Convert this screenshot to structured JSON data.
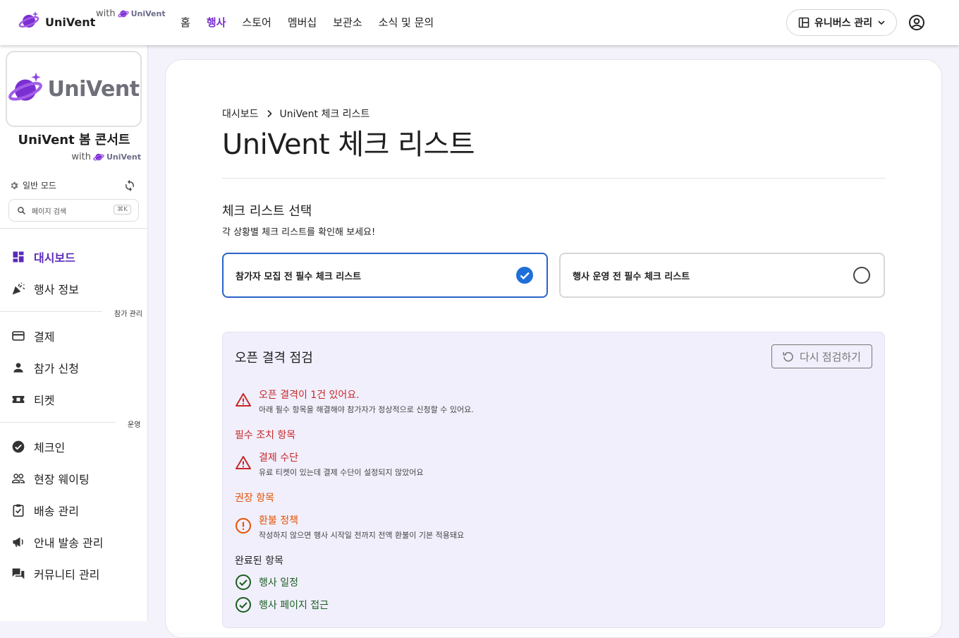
{
  "header": {
    "brand": "UniVent",
    "with": "with",
    "with_brand": "UniVent",
    "nav": [
      "홈",
      "행사",
      "스토어",
      "멤버십",
      "보관소",
      "소식 및 문의"
    ],
    "active_nav": "행사",
    "manage_label": "유니버스 관리"
  },
  "sidebar": {
    "logo_text": "UniVent",
    "event_name": "UniVent 봄 콘서트",
    "event_with": "with",
    "event_with_brand": "UniVent",
    "mode_label": "일반 모드",
    "search_placeholder": "페이지 검색",
    "search_shortcut": "⌘K",
    "section_participants": "참가 관리",
    "section_operations": "운영",
    "items": [
      {
        "label": "대시보드",
        "icon": "dashboard-icon"
      },
      {
        "label": "행사 정보",
        "icon": "party-popper-icon"
      },
      {
        "label": "결제",
        "icon": "credit-card-icon"
      },
      {
        "label": "참가 신청",
        "icon": "person-icon"
      },
      {
        "label": "티켓",
        "icon": "ticket-icon"
      },
      {
        "label": "체크인",
        "icon": "check-circle-icon"
      },
      {
        "label": "현장 웨이팅",
        "icon": "people-icon"
      },
      {
        "label": "배송 관리",
        "icon": "clipboard-check-icon"
      },
      {
        "label": "안내 발송 관리",
        "icon": "megaphone-icon"
      },
      {
        "label": "커뮤니티 관리",
        "icon": "forum-icon"
      }
    ]
  },
  "main": {
    "breadcrumb": [
      "대시보드",
      "UniVent 체크 리스트"
    ],
    "title": "UniVent 체크 리스트",
    "select_title": "체크 리스트 선택",
    "select_desc": "각 상황별 체크 리스트를 확인해 보세요!",
    "options": [
      {
        "label": "참가자 모집 전 필수 체크 리스트",
        "selected": true
      },
      {
        "label": "행사 운영 전 필수 체크 리스트",
        "selected": false
      }
    ],
    "panel": {
      "title": "오픈 결격 점검",
      "recheck_label": "다시 점검하기",
      "summary_title": "오픈 결격이 1건 있어요.",
      "summary_desc": "아래 필수 항목을 해결해야 참가자가 정상적으로 신청할 수 있어요.",
      "required_label": "필수 조치 항목",
      "required_item_title": "결제 수단",
      "required_item_desc": "유료 티켓이 있는데 결제 수단이 설정되지 않았어요",
      "recommended_label": "권장 항목",
      "recommended_item_title": "환불 정책",
      "recommended_item_desc": "작성하지 않으면 행사 시작일 전까지 전액 환불이 기본 적용돼요",
      "completed_label": "완료된 항목",
      "completed_items": [
        "행사 일정",
        "행사 페이지 접근"
      ]
    },
    "colors": {
      "accent": "#7b2fd1",
      "selected_border": "#2a63c9",
      "error": "#c62828",
      "warning": "#e65100",
      "success": "#1b5e20",
      "panel_bg": "#f1effc"
    }
  }
}
